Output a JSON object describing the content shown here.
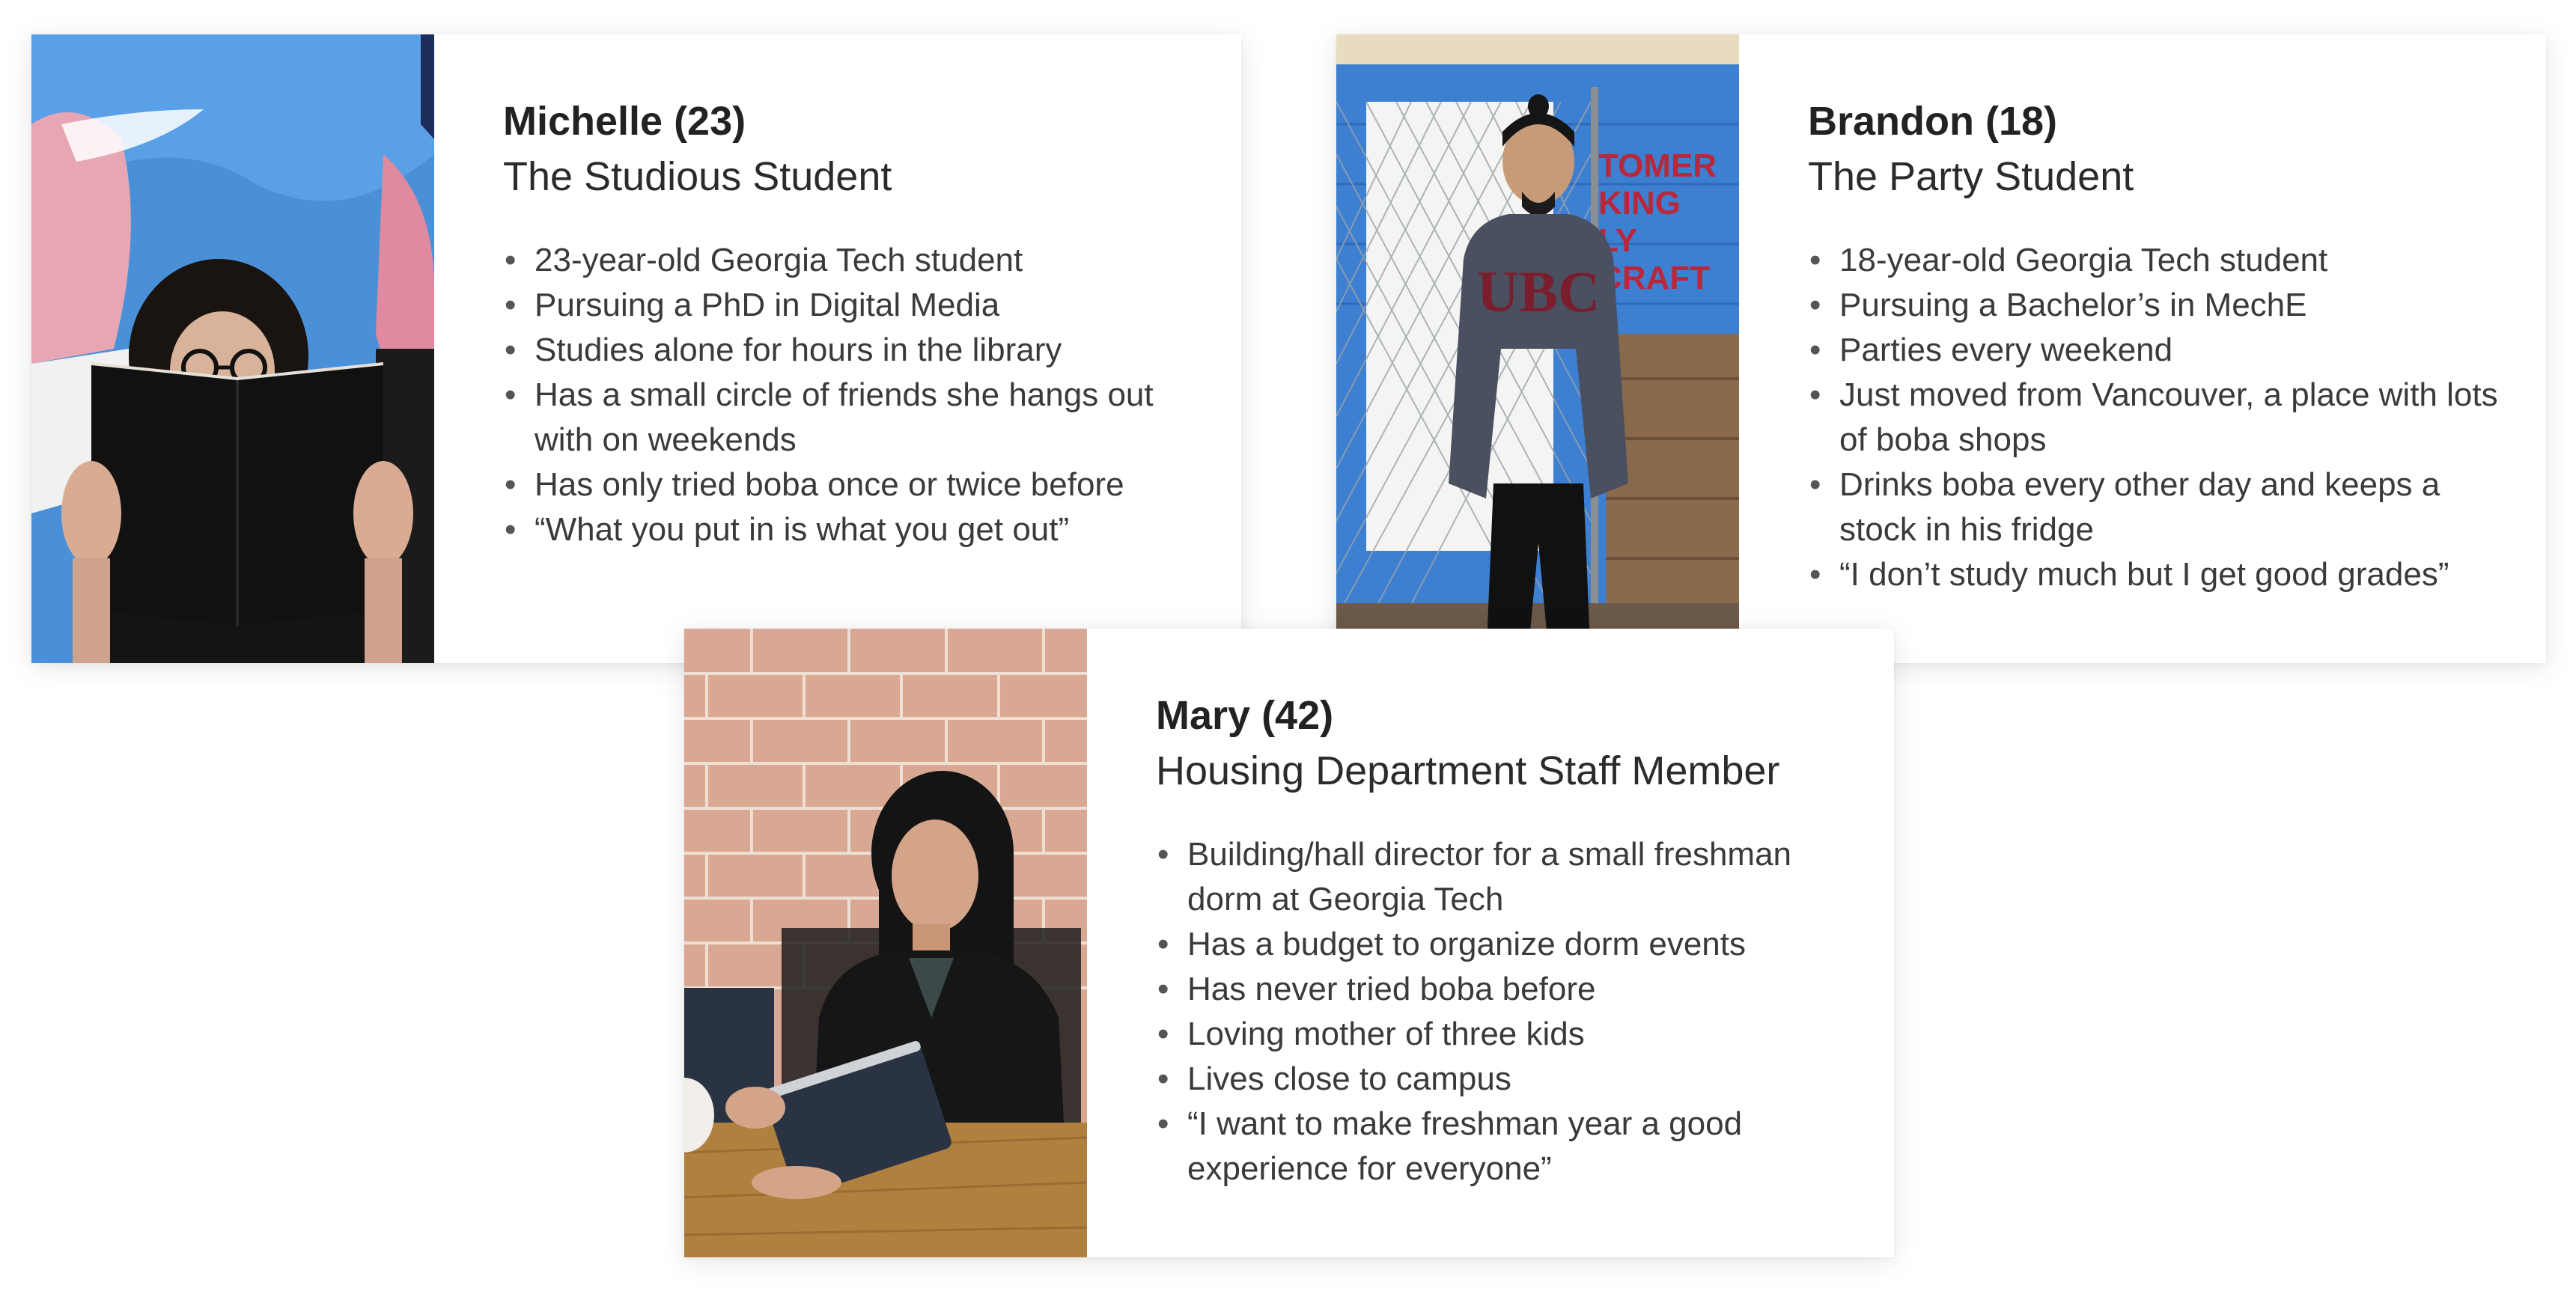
{
  "personas": [
    {
      "name": "Michelle (23)",
      "role": "The Studious Student",
      "bullets": [
        "23-year-old Georgia Tech student",
        "Pursuing a PhD in Digital Media",
        "Studies alone for hours in the library",
        "Has a small circle of friends she hangs out with on weekends",
        "Has only tried boba once or twice before",
        "“What you put in is what you get out”"
      ]
    },
    {
      "name": "Brandon (18)",
      "role": "The Party Student",
      "photo_text": {
        "sweater": "UBC",
        "mural": [
          "TOMER",
          "KING",
          "LY",
          "CRAFT"
        ]
      },
      "bullets": [
        "18-year-old Georgia Tech student",
        "Pursuing a Bachelor’s in MechE",
        "Parties every weekend",
        "Just moved from Vancouver, a place with lots of boba shops",
        "Drinks boba every other day and keeps a stock in his fridge",
        "“I don’t study much but I get good grades”"
      ]
    },
    {
      "name": "Mary (42)",
      "role": "Housing Department Staff Member",
      "bullets": [
        "Building/hall director for a small freshman dorm at Georgia Tech",
        "Has a budget to organize dorm events",
        "Has never tried boba before",
        "Loving mother of three kids",
        "Lives close to campus",
        "“I want to make freshman year a good experience for everyone”"
      ]
    }
  ]
}
